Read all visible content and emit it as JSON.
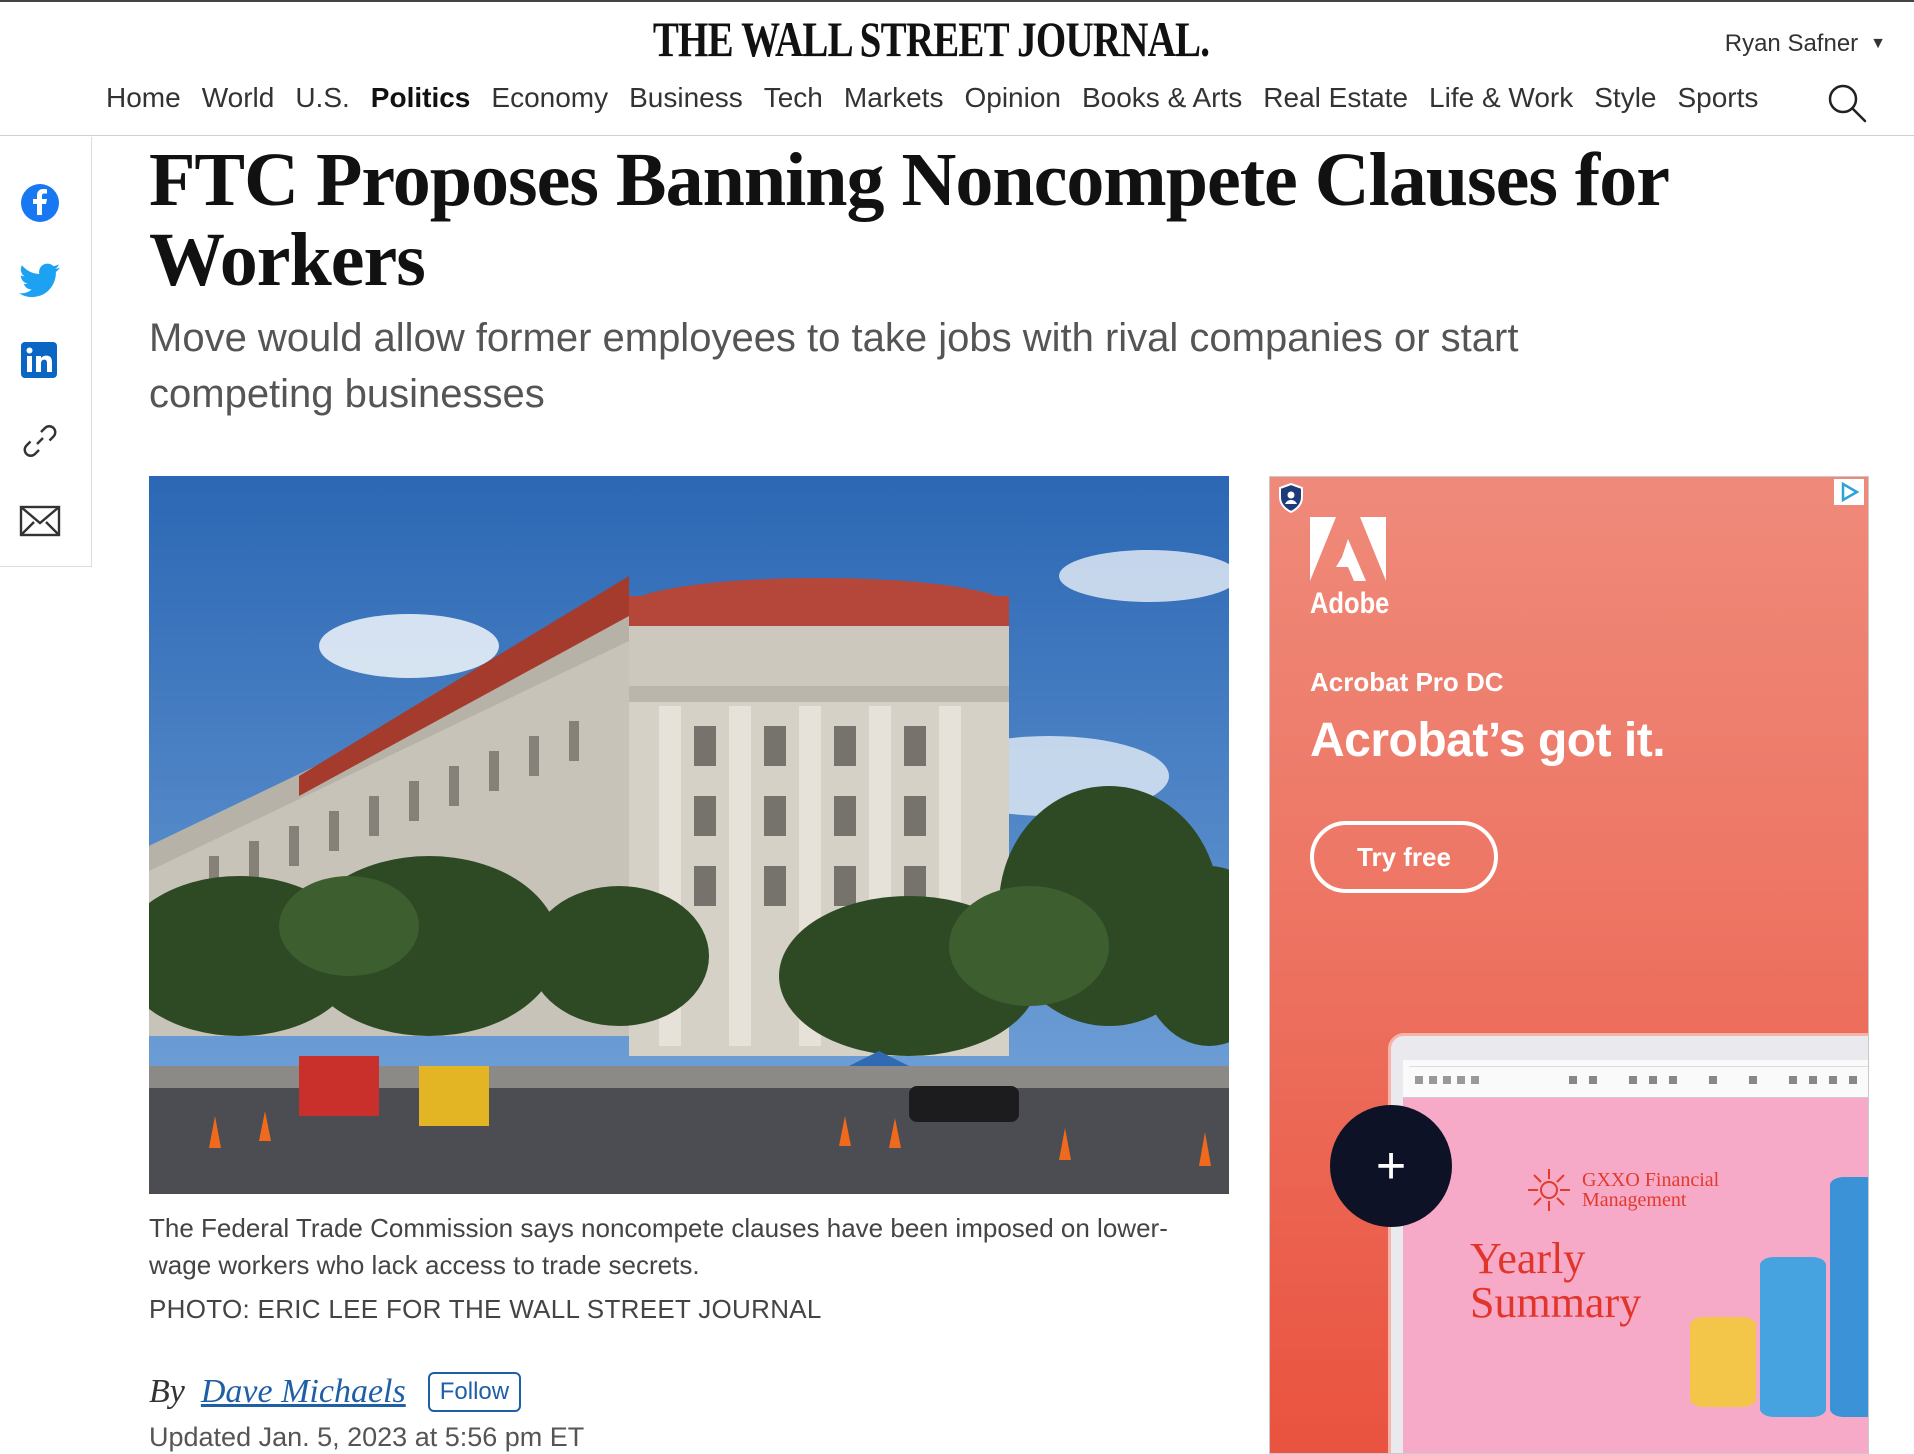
{
  "masthead": {
    "logo": "THE WALL STREET JOURNAL.",
    "user_name": "Ryan Safner",
    "nav": [
      "Home",
      "World",
      "U.S.",
      "Politics",
      "Economy",
      "Business",
      "Tech",
      "Markets",
      "Opinion",
      "Books & Arts",
      "Real Estate",
      "Life & Work",
      "Style",
      "Sports"
    ],
    "active_nav": "Politics"
  },
  "share": [
    "facebook-icon",
    "twitter-icon",
    "linkedin-icon",
    "link-icon",
    "email-icon"
  ],
  "article": {
    "headline": "FTC Proposes Banning Noncompete Clauses for Workers",
    "dek": "Move would allow former employees to take jobs with rival companies or start competing businesses",
    "caption": "The Federal Trade Commission says noncompete clauses have been imposed on lower-wage workers who lack access to trade secrets.",
    "credit_label": "PHOTO:",
    "credit_name": "ERIC LEE FOR THE WALL STREET JOURNAL",
    "by": "By",
    "author": "Dave Michaels",
    "follow": "Follow",
    "updated": "Updated Jan. 5, 2023 at 5:56 pm ET"
  },
  "ad": {
    "brand": "Adobe",
    "product": "Acrobat Pro DC",
    "tagline": "Acrobat’s got it.",
    "cta": "Try free",
    "doc_company": "GXXO Financial Management",
    "doc_company_line1": "GXXO Financial",
    "doc_company_line2": "Management",
    "doc_title_line1": "Yearly",
    "doc_title_line2": "Summary",
    "accent": "#ee7766"
  }
}
